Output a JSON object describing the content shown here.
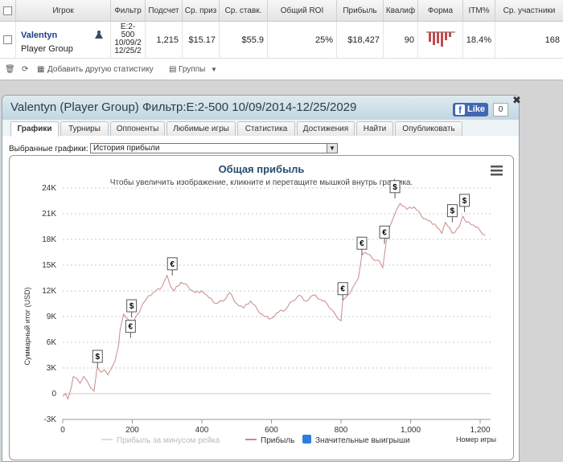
{
  "stats": {
    "headers": [
      "Игрок",
      "Фильтр",
      "Подсчет",
      "Ср. приз",
      "Ср. ставк.",
      "Общий ROI",
      "Прибыль",
      "Квалиф",
      "Форма",
      "ITM%",
      "Ср. участники"
    ],
    "row": {
      "player_name": "Valentyn",
      "player_group": "Player Group",
      "filter_lines": [
        "E:2-",
        "500",
        "10/09/2",
        "12/25/2"
      ],
      "count": "1,215",
      "avg_prize": "$15.17",
      "avg_stake": "$55.9",
      "roi": "25%",
      "profit": "$18,427",
      "qualif": "90",
      "itm": "18.4%",
      "avg_participants": "168"
    },
    "toolbar": {
      "add_stats": "Добавить другую статистику",
      "groups": "Группы"
    }
  },
  "window": {
    "title": "Valentyn (Player Group) Фильтр:E:2-500 10/09/2014-12/25/2029",
    "like_label": "Like",
    "like_count": "0",
    "tabs": [
      "Графики",
      "Турниры",
      "Оппоненты",
      "Любимые игры",
      "Статистика",
      "Достижения",
      "Найти",
      "Опубликовать"
    ],
    "select_label": "Выбранные графики:",
    "select_value": "История прибыли"
  },
  "chart_data": {
    "type": "line",
    "title": "Общая прибыль",
    "subtitle": "Чтобы увеличить изображение, кликните и перетащите мышкой внутрь графика.",
    "xlabel": "Номер игры",
    "ylabel": "Суммарный итог (USD)",
    "xlim": [
      0,
      1230
    ],
    "ylim": [
      -3000,
      24000
    ],
    "x_ticks": [
      "0",
      "200",
      "400",
      "600",
      "800",
      "1,000",
      "1,200"
    ],
    "x_tick_values": [
      0,
      200,
      400,
      600,
      800,
      1000,
      1200
    ],
    "y_ticks": [
      "-3K",
      "0",
      "3K",
      "6K",
      "9K",
      "12K",
      "15K",
      "18K",
      "21K",
      "24K"
    ],
    "y_tick_values": [
      -3000,
      0,
      3000,
      6000,
      9000,
      12000,
      15000,
      18000,
      21000,
      24000
    ],
    "grid": "horizontal dashed",
    "legend_position": "bottom",
    "legend": [
      {
        "name": "Прибыль за минусом рейка",
        "color": "#dddddd"
      },
      {
        "name": "Прибыль",
        "color": "#c98a8a"
      },
      {
        "name": "Значительные выигрыши",
        "color": "#2f7ed8"
      }
    ],
    "series": [
      {
        "name": "Прибыль",
        "color": "#c98a8a",
        "x": [
          0,
          8,
          15,
          25,
          30,
          40,
          50,
          60,
          70,
          80,
          90,
          98,
          100,
          110,
          120,
          130,
          140,
          150,
          160,
          165,
          175,
          190,
          200,
          210,
          220,
          230,
          240,
          260,
          280,
          300,
          310,
          320,
          340,
          360,
          380,
          400,
          420,
          440,
          460,
          480,
          500,
          520,
          540,
          560,
          580,
          600,
          620,
          640,
          660,
          680,
          700,
          720,
          740,
          760,
          780,
          790,
          800,
          805,
          820,
          840,
          850,
          860,
          870,
          890,
          910,
          920,
          930,
          940,
          950,
          960,
          970,
          990,
          1010,
          1030,
          1050,
          1070,
          1090,
          1100,
          1120,
          1140,
          1150,
          1160,
          1180,
          1200,
          1215
        ],
        "y": [
          -300,
          0,
          -600,
          800,
          2000,
          1800,
          1200,
          2000,
          1500,
          700,
          300,
          2800,
          3000,
          2500,
          2800,
          2200,
          3000,
          3800,
          5500,
          7500,
          9300,
          8600,
          8000,
          9000,
          9500,
          10500,
          11000,
          11800,
          12200,
          13800,
          12500,
          12000,
          13000,
          12500,
          11800,
          12000,
          11200,
          10500,
          10800,
          11800,
          10500,
          10000,
          10800,
          9800,
          9000,
          8800,
          9500,
          9800,
          10800,
          11500,
          10800,
          11500,
          11000,
          10500,
          9500,
          8800,
          8500,
          10900,
          11500,
          12800,
          13500,
          16200,
          16500,
          15800,
          15500,
          14700,
          17700,
          19500,
          20500,
          21500,
          22200,
          21500,
          21800,
          20800,
          20200,
          19800,
          18700,
          20000,
          18700,
          19500,
          20700,
          20000,
          19700,
          19000,
          18500
        ]
      }
    ],
    "markers": [
      {
        "x": 100,
        "y": 3000,
        "symbol": "$"
      },
      {
        "x": 195,
        "y": 6500,
        "symbol": "€"
      },
      {
        "x": 198,
        "y": 8900,
        "symbol": "$"
      },
      {
        "x": 315,
        "y": 13800,
        "symbol": "€"
      },
      {
        "x": 805,
        "y": 10900,
        "symbol": "€"
      },
      {
        "x": 860,
        "y": 16200,
        "symbol": "€"
      },
      {
        "x": 925,
        "y": 17500,
        "symbol": "€"
      },
      {
        "x": 955,
        "y": 22800,
        "symbol": "$"
      },
      {
        "x": 1120,
        "y": 20000,
        "symbol": "$"
      },
      {
        "x": 1155,
        "y": 21200,
        "symbol": "$"
      }
    ]
  }
}
